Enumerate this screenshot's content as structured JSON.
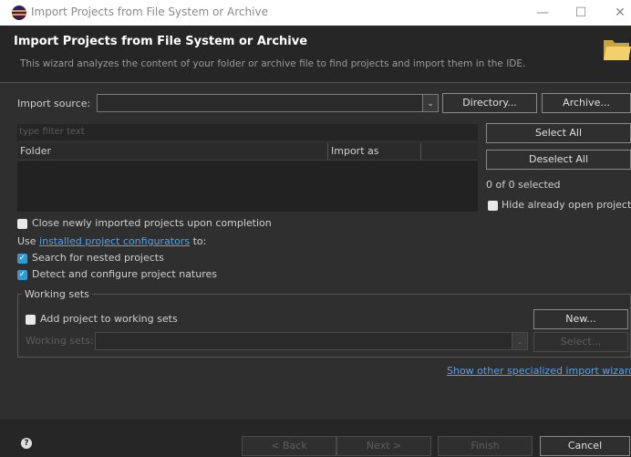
{
  "window": {
    "title": "Import Projects from File System or Archive",
    "minimize": "—",
    "maximize": "☐",
    "close": "✕"
  },
  "header": {
    "title": "Import Projects from File System or Archive",
    "description": "This wizard analyzes the content of your folder or archive file to find projects and import them in the IDE."
  },
  "import_source": {
    "label": "Import source:",
    "value": "",
    "directory_button": "Directory...",
    "archive_button": "Archive..."
  },
  "filter": {
    "placeholder": "type filter text"
  },
  "table": {
    "columns": [
      "Folder",
      "Import as"
    ],
    "rows": []
  },
  "side": {
    "select_all": "Select All",
    "deselect_all": "Deselect All",
    "selected_count": "0 of 0 selected",
    "hide_open_projects": "Hide already open projects"
  },
  "options": {
    "close_projects": "Close newly imported projects upon completion",
    "use_prefix": "Use ",
    "configurators_link": "installed project configurators",
    "use_suffix": " to:",
    "search_nested": "Search for nested projects",
    "detect_natures": "Detect and configure project natures"
  },
  "working_sets": {
    "group_title": "Working sets",
    "add_label": "Add project to working sets",
    "new_button": "New...",
    "label": "Working sets:",
    "select_button": "Select..."
  },
  "other_wizards_link": "Show other specialized import wizards",
  "footer": {
    "help": "?",
    "back": "< Back",
    "next": "Next >",
    "finish": "Finish",
    "cancel": "Cancel"
  },
  "colors": {
    "background": "#2f2f2f",
    "header_bg": "#262626",
    "accent": "#2f9bd6",
    "link": "#5aa0e0"
  }
}
